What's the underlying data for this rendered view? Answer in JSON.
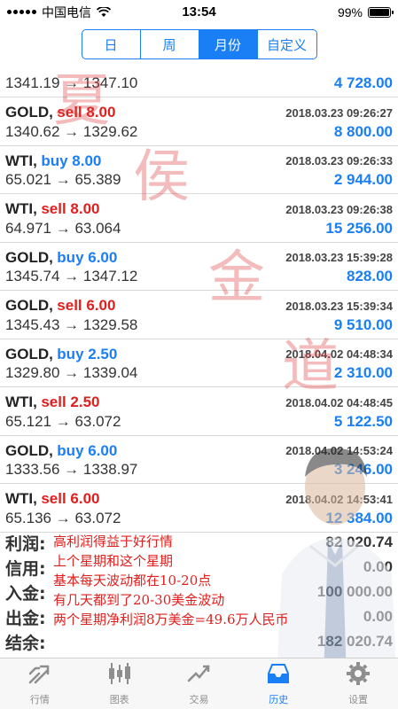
{
  "status_bar": {
    "carrier": "中国电信",
    "time": "13:54",
    "battery": "99%",
    "battery_level": 0.99
  },
  "segments": [
    {
      "label": "日",
      "active": false
    },
    {
      "label": "周",
      "active": false
    },
    {
      "label": "月份",
      "active": true
    },
    {
      "label": "自定义",
      "active": false
    }
  ],
  "trades": [
    {
      "symbol": "",
      "side": "",
      "side_type": "buy",
      "date": "",
      "prices": "1341.19 → 1347.10",
      "profit": "4 728.00"
    },
    {
      "symbol": "GOLD,",
      "side": "sell 8.00",
      "side_type": "sell",
      "date": "2018.03.23 09:26:27",
      "prices": "1340.62 → 1329.62",
      "profit": "8 800.00"
    },
    {
      "symbol": "WTI,",
      "side": "buy 8.00",
      "side_type": "buy",
      "date": "2018.03.23 09:26:33",
      "prices": "65.021 → 65.389",
      "profit": "2 944.00"
    },
    {
      "symbol": "WTI,",
      "side": "sell 8.00",
      "side_type": "sell",
      "date": "2018.03.23 09:26:38",
      "prices": "64.971 → 63.064",
      "profit": "15 256.00"
    },
    {
      "symbol": "GOLD,",
      "side": "buy 6.00",
      "side_type": "buy",
      "date": "2018.03.23 15:39:28",
      "prices": "1345.74 → 1347.12",
      "profit": "828.00"
    },
    {
      "symbol": "GOLD,",
      "side": "sell 6.00",
      "side_type": "sell",
      "date": "2018.03.23 15:39:34",
      "prices": "1345.43 → 1329.58",
      "profit": "9 510.00"
    },
    {
      "symbol": "GOLD,",
      "side": "buy 2.50",
      "side_type": "buy",
      "date": "2018.04.02 04:48:34",
      "prices": "1329.80 → 1339.04",
      "profit": "2 310.00"
    },
    {
      "symbol": "WTI,",
      "side": "sell 2.50",
      "side_type": "sell",
      "date": "2018.04.02 04:48:45",
      "prices": "65.121 → 63.072",
      "profit": "5 122.50"
    },
    {
      "symbol": "GOLD,",
      "side": "buy 6.00",
      "side_type": "buy",
      "date": "2018.04.02 14:53:24",
      "prices": "1333.56 → 1338.97",
      "profit": "3 246.00"
    },
    {
      "symbol": "WTI,",
      "side": "sell 6.00",
      "side_type": "sell",
      "date": "2018.04.02 14:53:41",
      "prices": "65.136 → 63.072",
      "profit": "12 384.00"
    }
  ],
  "summary": [
    {
      "label": "利润:",
      "value": "82 020.74"
    },
    {
      "label": "信用:",
      "value": "0.00"
    },
    {
      "label": "入金:",
      "value": "100 000.00"
    },
    {
      "label": "出金:",
      "value": "0.00"
    },
    {
      "label": "结余:",
      "value": "182 020.74"
    }
  ],
  "promo_lines": [
    "高利润得益于好行情",
    "上个星期和这个星期",
    "基本每天波动都在10-20点",
    "有几天都到了20-30美金波动",
    "两个星期净利润8万美金=49.6万人民币"
  ],
  "watermark": [
    "夏",
    "侯",
    "金",
    "道"
  ],
  "tabs": [
    {
      "label": "行情",
      "icon": "quotes-icon",
      "active": false
    },
    {
      "label": "图表",
      "icon": "chart-icon",
      "active": false
    },
    {
      "label": "交易",
      "icon": "trade-icon",
      "active": false
    },
    {
      "label": "历史",
      "icon": "history-icon",
      "active": true
    },
    {
      "label": "设置",
      "icon": "settings-icon",
      "active": false
    }
  ],
  "colors": {
    "accent": "#1a7ff5",
    "sell": "#e0201e",
    "buy": "#1a7ff5"
  }
}
